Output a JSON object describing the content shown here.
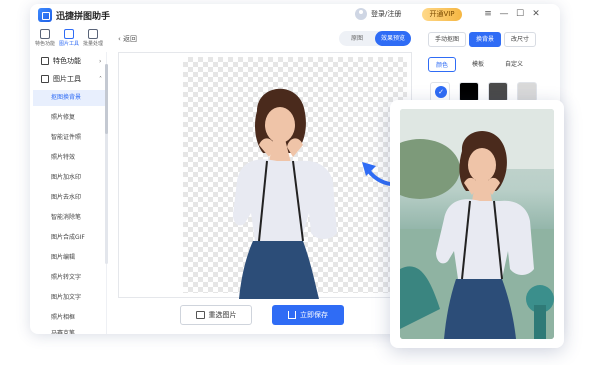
{
  "app": {
    "title": "迅捷拼图助手"
  },
  "user": {
    "login_label": "登录/注册",
    "vip_label": "开通VIP"
  },
  "window_controls": {
    "menu": "≡",
    "min": "—",
    "max": "☐",
    "close": "✕"
  },
  "nav_tabs": [
    {
      "label": "特色功能",
      "icon": "grid-icon"
    },
    {
      "label": "图片工具",
      "icon": "image-tool-icon"
    },
    {
      "label": "批量处理",
      "icon": "batch-icon"
    }
  ],
  "sidebar": {
    "section1": {
      "label": "特色功能",
      "chevron": "›"
    },
    "section2": {
      "label": "图片工具",
      "chevron": "˄"
    },
    "items": [
      "抠图换背景",
      "照片修复",
      "智能证件照",
      "照片特效",
      "图片加水印",
      "图片去水印",
      "智能消除笔",
      "图片合成GIF",
      "图片编辑",
      "照片转文字",
      "图片加文字",
      "照片相框",
      "马赛克笔"
    ]
  },
  "editor": {
    "back_label": "返回",
    "view_toggle": [
      "原图",
      "效果预览"
    ],
    "reselect_label": "重选图片",
    "save_label": "立即保存"
  },
  "right_panel": {
    "mode_tabs": [
      "手动抠图",
      "换背景",
      "改尺寸"
    ],
    "sub_tabs": [
      "颜色",
      "模板",
      "自定义"
    ],
    "swatches": [
      "#ffffff",
      "#000000",
      "#4a4a4a",
      "#d9d9d9"
    ]
  },
  "colors": {
    "accent": "#2f6cf5",
    "vip": "#f5b642"
  }
}
